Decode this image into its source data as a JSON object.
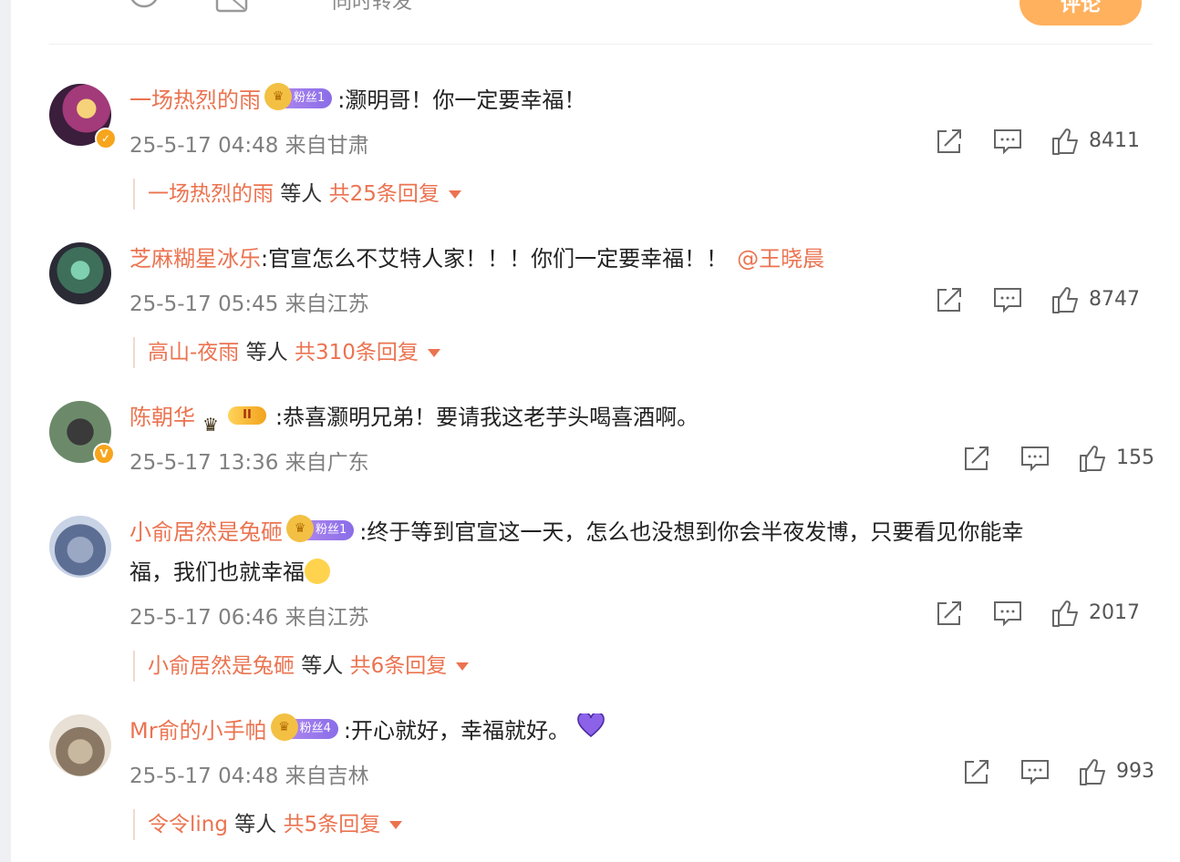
{
  "topbar": {
    "cut_text": "同时转发",
    "post_button": "评论"
  },
  "comments": [
    {
      "user": "一场热烈的雨",
      "badge": "粉丝1",
      "text": ":灏明哥！你一定要幸福！",
      "meta": "25-5-17 04:48 来自甘肃",
      "likes": "8411",
      "reply_name": "一场热烈的雨",
      "reply_mid": " 等人 ",
      "reply_total": "共25条回复"
    },
    {
      "user": "芝麻糊星冰乐",
      "text": ":官宣怎么不艾特人家！！！你们一定要幸福！！",
      "mention": "@王晓晨",
      "meta": "25-5-17 05:45 来自江苏",
      "likes": "8747",
      "reply_name": "高山-夜雨",
      "reply_mid": " 等人 ",
      "reply_total": "共310条回复"
    },
    {
      "user": "陈朝华",
      "badge": "II",
      "text": ":恭喜灏明兄弟！要请我这老芋头喝喜酒啊。",
      "meta": "25-5-17 13:36 来自广东",
      "likes": "155"
    },
    {
      "user": "小俞居然是兔砸",
      "badge": "粉丝1",
      "text": ":终于等到官宣这一天，怎么也没想到你会半夜发博，只要看见你能幸",
      "text2": "福，我们也就幸福",
      "meta": "25-5-17 06:46 来自江苏",
      "likes": "2017",
      "reply_name": "小俞居然是兔砸",
      "reply_mid": " 等人 ",
      "reply_total": "共6条回复"
    },
    {
      "user": "Mr俞的小手帕",
      "badge": "粉丝4",
      "text": ":开心就好，幸福就好。",
      "meta": "25-5-17 04:48 来自吉林",
      "likes": "993",
      "reply_name": "令令ling",
      "reply_mid": " 等人 ",
      "reply_total": "共5条回复"
    }
  ],
  "icons": {
    "share": "share-icon",
    "comment": "comment-icon",
    "like": "like-icon"
  },
  "colors": {
    "username": "#eb7350",
    "post_button": "#ffb15e",
    "fan_badge": "#8a6de8",
    "verified": "#f7a51c"
  }
}
